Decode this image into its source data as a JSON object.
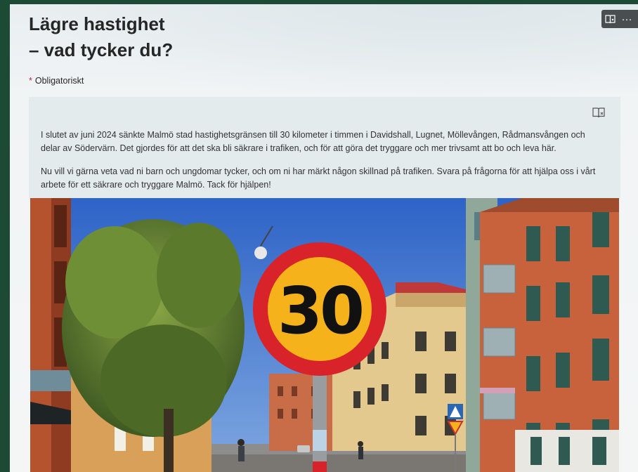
{
  "form": {
    "title_line1": "Lägre hastighet",
    "title_line2": "– vad tycker du?",
    "required_marker": "*",
    "required_label": "Obligatoriskt"
  },
  "toolbar": {
    "immersive_reader_icon": "immersive-reader-icon",
    "more_icon": "more-options-icon",
    "more_glyph": "···"
  },
  "intro": {
    "reader_icon": "immersive-reader-icon",
    "paragraph1": "I slutet av juni 2024 sänkte Malmö stad hastighetsgränsen till 30 kilometer i timmen i Davidshall, Lugnet, Möllevången, Rådmansvången och delar av Södervärn. Det gjordes för att det ska bli säkrare i trafiken, och för att göra det tryggare och mer trivsamt att bo och leva här.",
    "paragraph2": "Nu vill vi gärna veta vad ni barn och ungdomar tycker, och om ni har märkt någon skillnad på trafiken. Svara på frågorna för att hjälpa oss i vårt arbete för ett säkrare och tryggare Malmö. Tack för hjälpen!"
  },
  "photo": {
    "sign_value": "30"
  },
  "colors": {
    "background": "#1d4a34",
    "accent_required": "#c4262e",
    "sign_red": "#d8232a",
    "sign_yellow": "#f5b21b"
  }
}
